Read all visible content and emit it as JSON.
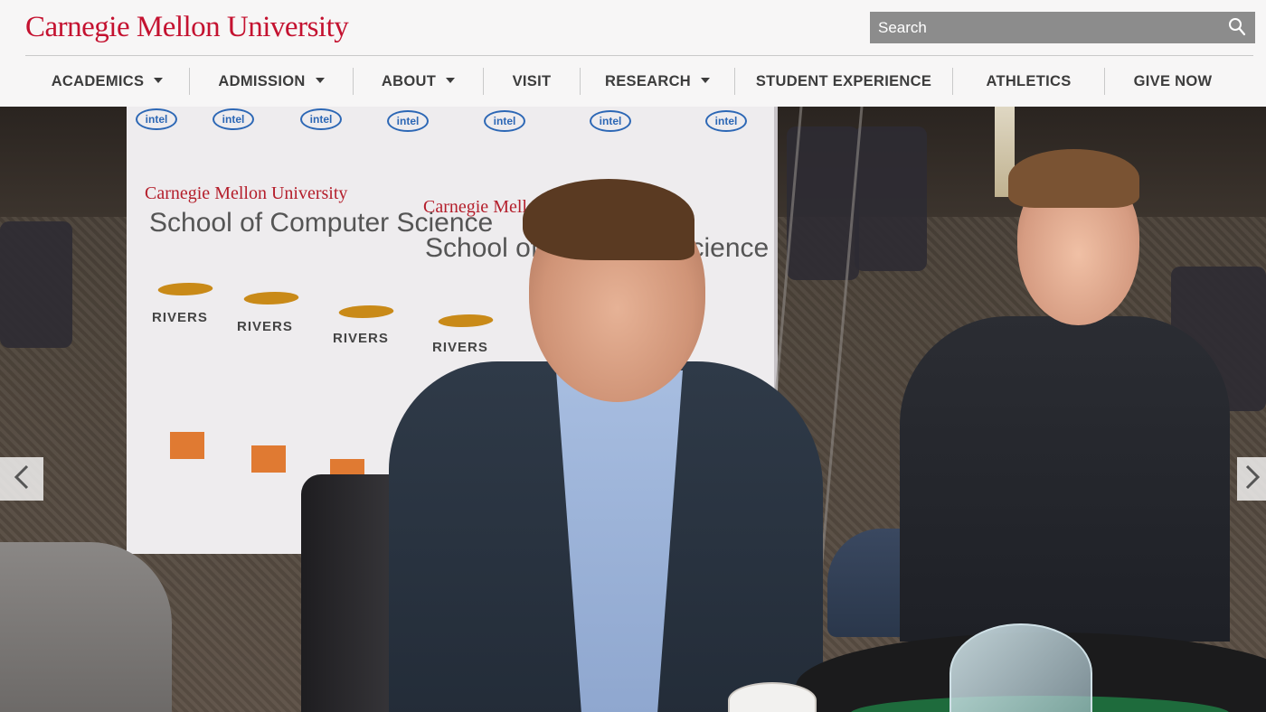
{
  "brand": {
    "wordmark": "Carnegie Mellon University",
    "color": "#c41230"
  },
  "search": {
    "placeholder": "Search",
    "icon": "search-icon"
  },
  "nav": {
    "items": [
      {
        "label": "ACADEMICS",
        "has_dropdown": true
      },
      {
        "label": "ADMISSION",
        "has_dropdown": true
      },
      {
        "label": "ABOUT",
        "has_dropdown": true
      },
      {
        "label": "VISIT",
        "has_dropdown": false
      },
      {
        "label": "RESEARCH",
        "has_dropdown": true
      },
      {
        "label": "STUDENT EXPERIENCE",
        "has_dropdown": false
      },
      {
        "label": "ATHLETICS",
        "has_dropdown": false
      },
      {
        "label": "GIVE NOW",
        "has_dropdown": false
      }
    ]
  },
  "hero": {
    "banner": {
      "logo_text": "intel",
      "cmu_text": "Carnegie Mellon University",
      "scs_text": "School of Computer Science",
      "sponsor_text": "RIVERS"
    }
  },
  "carousel": {
    "prev_icon": "chevron-left-icon",
    "next_icon": "chevron-right-icon"
  }
}
